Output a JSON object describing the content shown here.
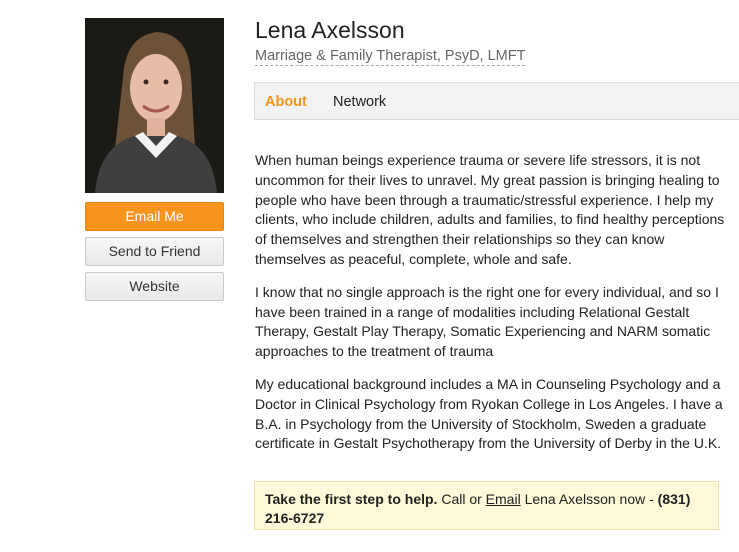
{
  "profile": {
    "name": "Lena Axelsson",
    "credentials": "Marriage & Family Therapist, PsyD, LMFT"
  },
  "actions": {
    "email_label": "Email Me",
    "send_label": "Send to Friend",
    "website_label": "Website"
  },
  "tabs": {
    "about": "About",
    "network": "Network",
    "active": "About"
  },
  "bio": {
    "paragraphs": [
      "When human beings experience trauma or severe life stressors, it is not uncommon for their lives to unravel. My great passion is bringing healing to people who have been through a traumatic/stressful experience. I help my clients, who include children, adults and families, to find healthy perceptions of themselves and strengthen their relationships so they can know themselves as peaceful, complete, whole and safe.",
      "I know that no single approach is the right one for every individual, and so I have been trained in a range of modalities including Relational Gestalt Therapy, Gestalt Play Therapy, Somatic Experiencing and NARM somatic approaches to the treatment of trauma",
      "My educational background includes a MA in Counseling Psychology and a Doctor in Clinical Psychology from Ryokan College in Los Angeles. I have a B.A. in Psychology from the University of Stockholm, Sweden a graduate certificate in Gestalt Psychotherapy from the University of Derby in the U.K."
    ]
  },
  "cta": {
    "lead": "Take the first step to help.",
    "call_text": " Call or ",
    "email_link": "Email",
    "after_text": " Lena Axelsson now - ",
    "phone": "(831) 216-6727"
  },
  "colors": {
    "accent": "#f7941d",
    "cta_background": "#fdf9d8"
  }
}
